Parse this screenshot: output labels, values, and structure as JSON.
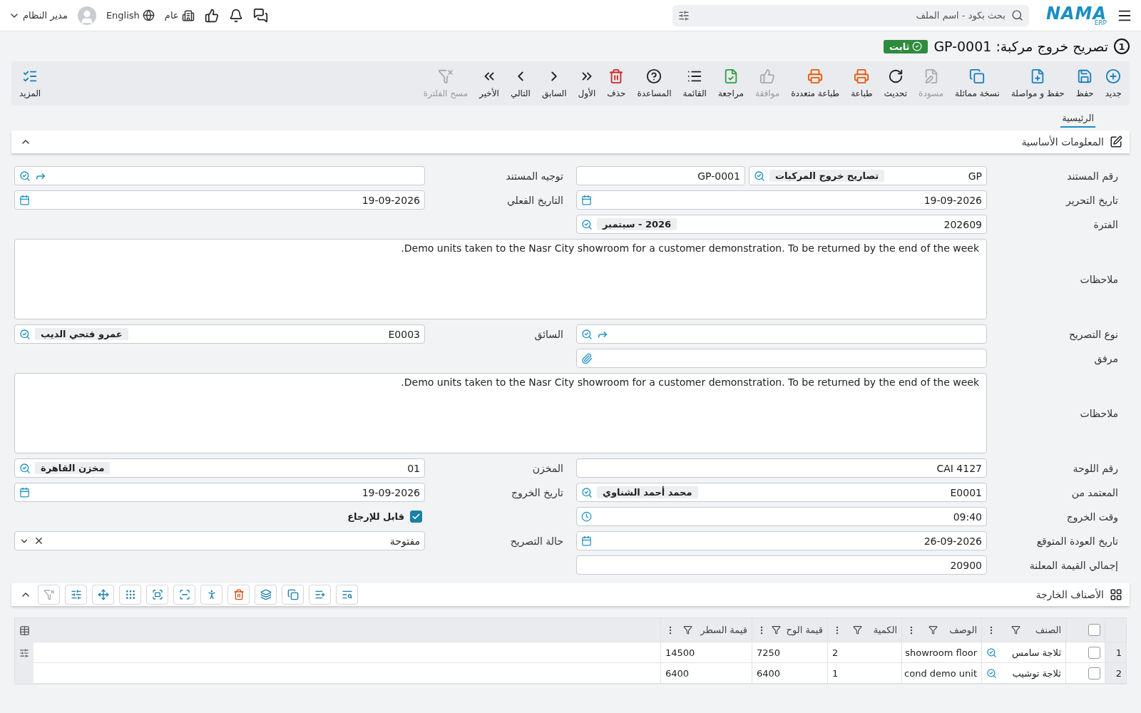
{
  "topbar": {
    "logo": "NAMA",
    "logo_sub": "ERP",
    "search_placeholder": "بحث بكود - اسم الملف",
    "user": "مدير النظام",
    "language": "English",
    "company": "عام"
  },
  "title": {
    "number": "1",
    "text": "تصريح خروج مركبة: GP-0001",
    "status": "ثابت"
  },
  "toolbar": [
    {
      "label": "جديد",
      "disabled": false
    },
    {
      "label": "حفظ",
      "disabled": false
    },
    {
      "label": "حفظ و مواصلة",
      "disabled": false
    },
    {
      "label": "نسخة مماثلة",
      "disabled": false
    },
    {
      "label": "مسودة",
      "disabled": true
    },
    {
      "label": "تحديث",
      "disabled": false
    },
    {
      "label": "طباعة",
      "disabled": false
    },
    {
      "label": "طباعة متعددة",
      "disabled": false
    },
    {
      "label": "موافقة",
      "disabled": true
    },
    {
      "label": "مراجعة",
      "disabled": false
    },
    {
      "label": "القائمة",
      "disabled": false
    },
    {
      "label": "المساعدة",
      "disabled": false
    },
    {
      "label": "حذف",
      "disabled": false
    },
    {
      "label": "الأول",
      "disabled": false
    },
    {
      "label": "السابق",
      "disabled": false
    },
    {
      "label": "التالي",
      "disabled": false
    },
    {
      "label": "الأخير",
      "disabled": false
    },
    {
      "label": "مسح الفلترة",
      "disabled": true
    }
  ],
  "more_label": "المزيد",
  "tabs": [
    {
      "label": "الرئيسية",
      "selected": true
    }
  ],
  "section": {
    "title": "المعلومات الأساسية",
    "expanded": true
  },
  "rows": [
    {
      "fields": [
        {
          "kind": "docnum",
          "label": "رقم المستند",
          "prefix": "GP",
          "chip": "تصاريح خروج المركبات",
          "value": "GP-0001"
        },
        {
          "kind": "link",
          "label": "توجيه المستند"
        }
      ]
    },
    {
      "fields": [
        {
          "kind": "date",
          "label": "تاريخ التحرير",
          "value": "19-09-2026"
        },
        {
          "kind": "date",
          "label": "التاريخ الفعلي",
          "value": "19-09-2026"
        }
      ]
    },
    {
      "fields": [
        {
          "kind": "lookup",
          "label": "الفترة",
          "value": "202609",
          "chip": "2026 - سبتمبر"
        }
      ]
    },
    {
      "fields": [
        {
          "kind": "textarea",
          "label": "ملاحظات",
          "value": "Demo units taken to the Nasr City showroom for a customer demonstration. To be returned by the end of the week."
        }
      ]
    },
    {
      "fields": [
        {
          "kind": "link",
          "label": "نوع التصريح"
        },
        {
          "kind": "lookup",
          "label": "السائق",
          "value": "E0003",
          "chip": "عمرو فتحي الديب"
        }
      ]
    },
    {
      "fields": [
        {
          "kind": "attachment",
          "label": "مرفق"
        }
      ]
    },
    {
      "fields": [
        {
          "kind": "textarea",
          "label": "ملاحظات",
          "value": "Demo units taken to the Nasr City showroom for a customer demonstration. To be returned by the end of the week."
        }
      ]
    },
    {
      "fields": [
        {
          "kind": "text",
          "label": "رقم اللوحة",
          "value": "CAI 4127"
        },
        {
          "kind": "lookup",
          "label": "المخزن",
          "value": "01",
          "chip": "مخزن القاهرة"
        }
      ]
    },
    {
      "fields": [
        {
          "kind": "lookup",
          "label": "المعتمد من",
          "value": "E0001",
          "chip": "محمد أحمد الشناوي"
        },
        {
          "kind": "date",
          "label": "تاريخ الخروج",
          "value": "19-09-2026"
        }
      ]
    },
    {
      "fields": [
        {
          "kind": "time",
          "label": "وقت الخروج",
          "value": "09:40"
        },
        {
          "kind": "checkbox",
          "label": "قابل للإرجاع",
          "checked": true
        }
      ]
    },
    {
      "fields": [
        {
          "kind": "date",
          "label": "تاريخ العودة المتوقع",
          "value": "26-09-2026"
        },
        {
          "kind": "select",
          "label": "حالة التصريح",
          "value": "مفتوحة"
        }
      ]
    },
    {
      "fields": [
        {
          "kind": "text",
          "label": "إجمالي القيمة المعلنة",
          "value": "20900"
        }
      ]
    }
  ],
  "items_section": {
    "title": "الأصناف الخارجة",
    "expanded": true,
    "tools": [
      {
        "disabled": false
      },
      {
        "disabled": false
      },
      {
        "disabled": false
      },
      {
        "disabled": false
      },
      {
        "disabled": false
      },
      {
        "disabled": false
      },
      {
        "disabled": false
      },
      {
        "disabled": false
      },
      {
        "disabled": false
      },
      {
        "disabled": false
      },
      {
        "disabled": false
      },
      {
        "disabled": true
      }
    ]
  },
  "table": {
    "header_checked": false,
    "columns": [
      "الصنف",
      "الوصف",
      "الكمية",
      "قيمة الوح",
      "قيمة السطر"
    ],
    "rows": [
      {
        "num": "1",
        "selected": false,
        "cells": [
          "ثلاجة سامس",
          "showroom floor",
          "2",
          "7250",
          "14500"
        ]
      },
      {
        "num": "2",
        "selected": false,
        "cells": [
          "ثلاجة توشيب",
          "cond demo unit",
          "1",
          "6400",
          "6400"
        ]
      }
    ]
  }
}
